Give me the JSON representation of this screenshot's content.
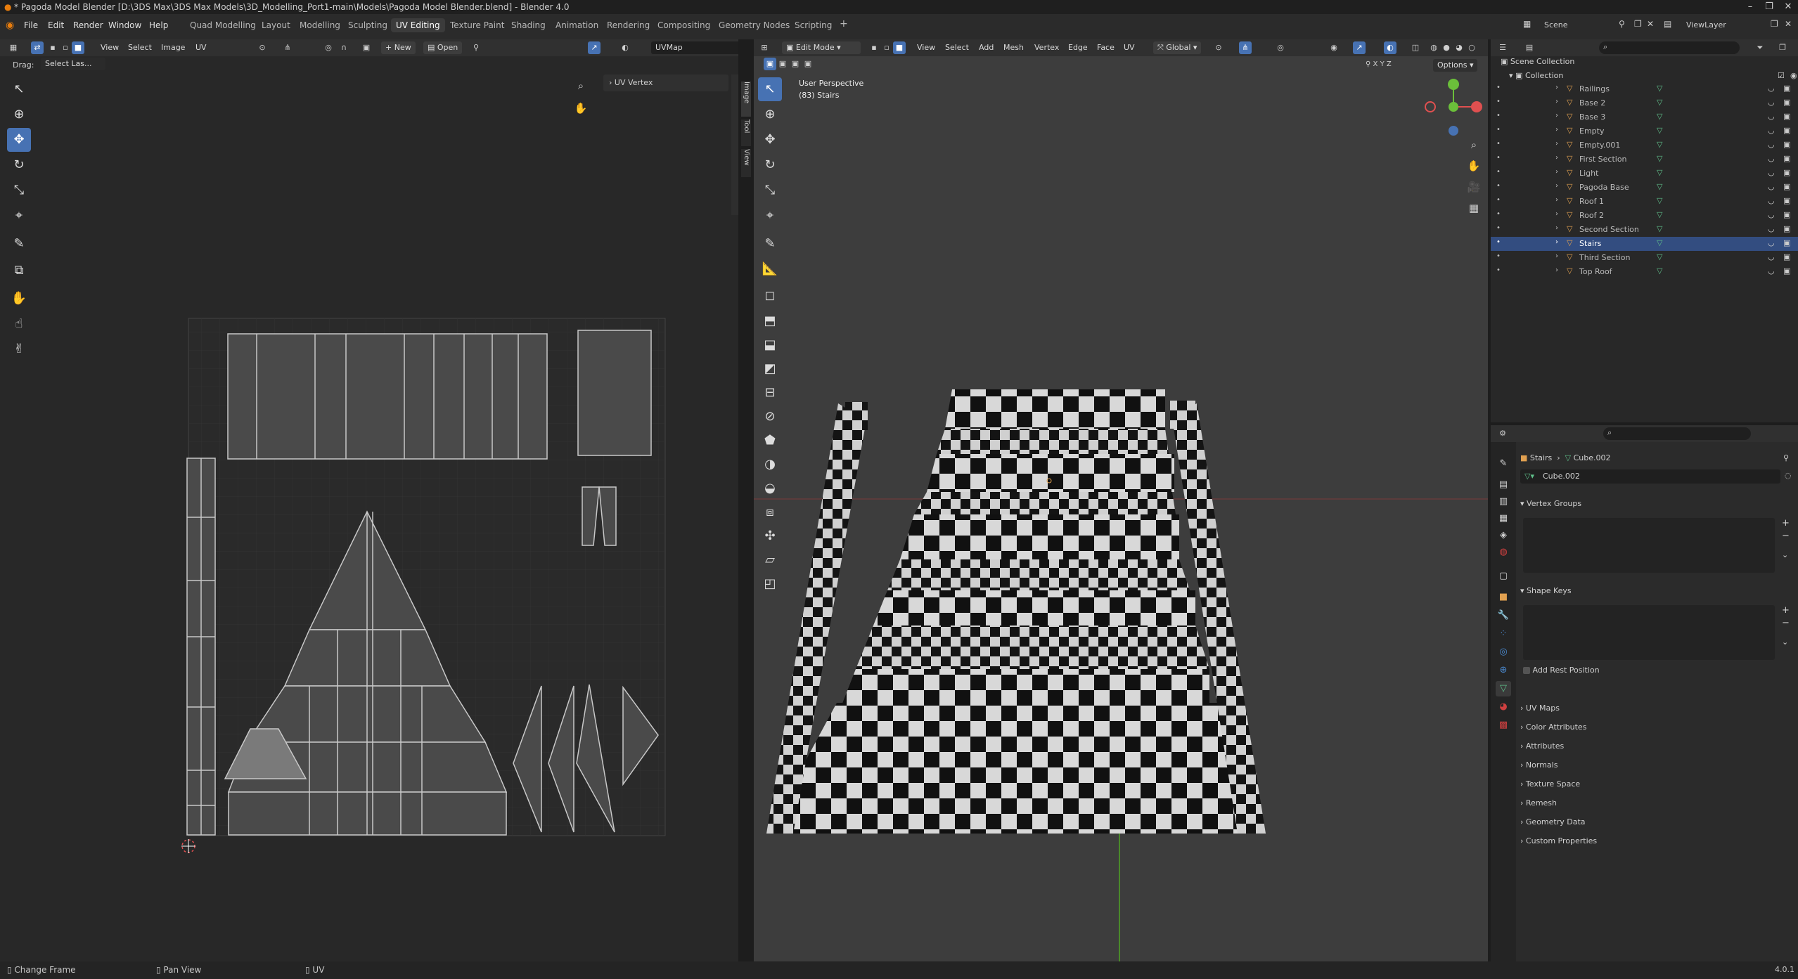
{
  "window": {
    "title": "* Pagoda Model Blender [D:\\3DS Max\\3DS Max Models\\3D_Modelling_Port1-main\\Models\\Pagoda Model Blender.blend] - Blender 4.0"
  },
  "menus": [
    "File",
    "Edit",
    "Render",
    "Window",
    "Help"
  ],
  "workspaces": [
    "Quad Modelling",
    "Layout",
    "Modelling",
    "Sculpting",
    "UV Editing",
    "Texture Paint",
    "Shading",
    "Animation",
    "Rendering",
    "Compositing",
    "Geometry Nodes",
    "Scripting"
  ],
  "active_workspace": "UV Editing",
  "scene_name": "Scene",
  "view_layer": "ViewLayer",
  "uv_editor": {
    "header_menus": [
      "View",
      "Select",
      "Image",
      "UV"
    ],
    "new_label": "New",
    "open_label": "Open",
    "uvmap_field": "UVMap",
    "drag_label": "Drag:",
    "drag_value": "Select Las...",
    "panel_title": "UV Vertex",
    "side_tabs": [
      "Image",
      "Tool",
      "View"
    ]
  },
  "viewport": {
    "mode": "Edit Mode",
    "header_menus": [
      "View",
      "Select",
      "Add",
      "Mesh",
      "Vertex",
      "Edge",
      "Face",
      "UV"
    ],
    "orientation": "Global",
    "options_label": "Options",
    "axes": [
      "X",
      "Y",
      "Z"
    ],
    "overlay_line1": "User Perspective",
    "overlay_line2": "(83) Stairs"
  },
  "outliner": {
    "root": "Scene Collection",
    "collection": "Collection",
    "items": [
      "Railings",
      "Base 2",
      "Base 3",
      "Empty",
      "Empty.001",
      "First Section",
      "Light",
      "Pagoda Base",
      "Roof 1",
      "Roof 2",
      "Second Section",
      "Stairs",
      "Third Section",
      "Top Roof"
    ],
    "selected": "Stairs"
  },
  "properties": {
    "breadcrumb_object": "Stairs",
    "breadcrumb_mesh": "Cube.002",
    "mesh_name": "Cube.002",
    "vertex_groups": "Vertex Groups",
    "shape_keys": "Shape Keys",
    "add_rest_position": "Add Rest Position",
    "sections": [
      "UV Maps",
      "Color Attributes",
      "Attributes",
      "Normals",
      "Texture Space",
      "Remesh",
      "Geometry Data",
      "Custom Properties"
    ]
  },
  "statusbar": {
    "item1": "Change Frame",
    "item2": "Pan View",
    "item3": "UV",
    "version": "4.0.1"
  },
  "colors": {
    "accent_blue": "#4772b3",
    "selected_row": "#334d80",
    "checker_dark": "#111111",
    "checker_light": "#d8d8d8"
  }
}
